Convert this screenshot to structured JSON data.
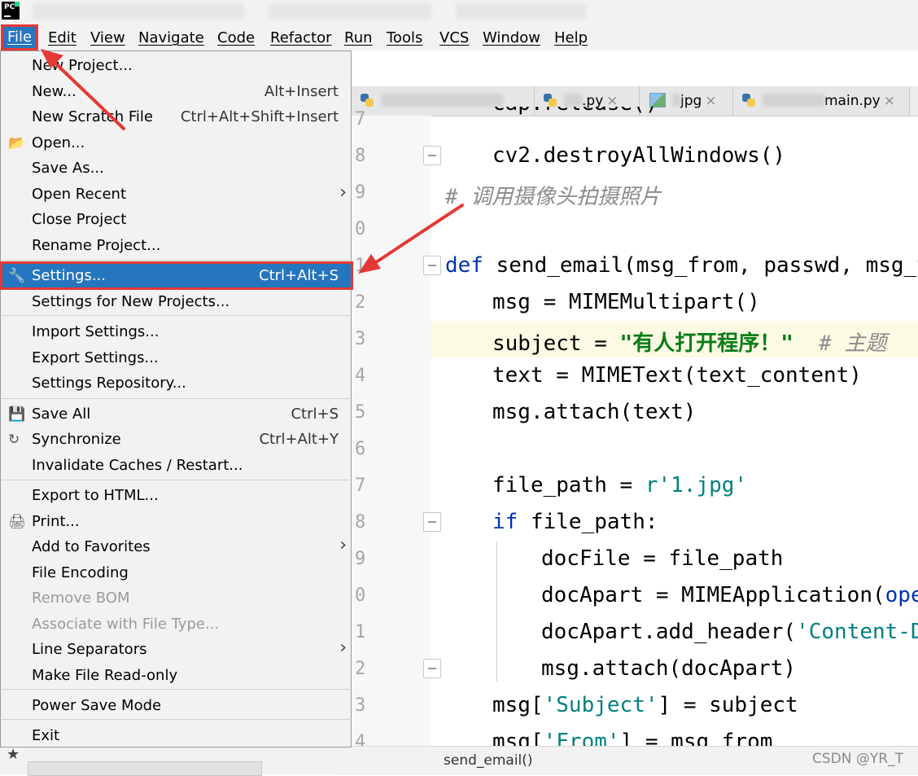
{
  "menubar": {
    "items": [
      "File",
      "Edit",
      "View",
      "Navigate",
      "Code",
      "Refactor",
      "Run",
      "Tools",
      "VCS",
      "Window",
      "Help"
    ]
  },
  "file_menu": {
    "items": [
      {
        "label": "New Project...",
        "shortcut": "",
        "has_submenu": false,
        "icon": ""
      },
      {
        "label": "New...",
        "shortcut": "Alt+Insert",
        "has_submenu": false,
        "icon": ""
      },
      {
        "label": "New Scratch File",
        "shortcut": "Ctrl+Alt+Shift+Insert",
        "has_submenu": false,
        "icon": ""
      },
      {
        "label": "Open...",
        "shortcut": "",
        "has_submenu": false,
        "icon": "folder-icon"
      },
      {
        "label": "Save As...",
        "shortcut": "",
        "has_submenu": false,
        "icon": ""
      },
      {
        "label": "Open Recent",
        "shortcut": "",
        "has_submenu": true,
        "icon": ""
      },
      {
        "label": "Close Project",
        "shortcut": "",
        "has_submenu": false,
        "icon": ""
      },
      {
        "label": "Rename Project...",
        "shortcut": "",
        "has_submenu": false,
        "icon": ""
      },
      {
        "label": "Settings...",
        "shortcut": "Ctrl+Alt+S",
        "has_submenu": false,
        "icon": "wrench-icon",
        "selected": true
      },
      {
        "label": "Settings for New Projects...",
        "shortcut": "",
        "has_submenu": false,
        "icon": ""
      },
      {
        "label": "Import Settings...",
        "shortcut": "",
        "has_submenu": false,
        "icon": ""
      },
      {
        "label": "Export Settings...",
        "shortcut": "",
        "has_submenu": false,
        "icon": ""
      },
      {
        "label": "Settings Repository...",
        "shortcut": "",
        "has_submenu": false,
        "icon": ""
      },
      {
        "label": "Save All",
        "shortcut": "Ctrl+S",
        "has_submenu": false,
        "icon": "save-icon"
      },
      {
        "label": "Synchronize",
        "shortcut": "Ctrl+Alt+Y",
        "has_submenu": false,
        "icon": "sync-icon"
      },
      {
        "label": "Invalidate Caches / Restart...",
        "shortcut": "",
        "has_submenu": false,
        "icon": ""
      },
      {
        "label": "Export to HTML...",
        "shortcut": "",
        "has_submenu": false,
        "icon": ""
      },
      {
        "label": "Print...",
        "shortcut": "",
        "has_submenu": false,
        "icon": "print-icon"
      },
      {
        "label": "Add to Favorites",
        "shortcut": "",
        "has_submenu": true,
        "icon": ""
      },
      {
        "label": "File Encoding",
        "shortcut": "",
        "has_submenu": false,
        "icon": ""
      },
      {
        "label": "Remove BOM",
        "shortcut": "",
        "has_submenu": false,
        "icon": "",
        "disabled": true
      },
      {
        "label": "Associate with File Type...",
        "shortcut": "",
        "has_submenu": false,
        "icon": "",
        "disabled": true
      },
      {
        "label": "Line Separators",
        "shortcut": "",
        "has_submenu": true,
        "icon": ""
      },
      {
        "label": "Make File Read-only",
        "shortcut": "",
        "has_submenu": false,
        "icon": ""
      },
      {
        "label": "Power Save Mode",
        "shortcut": "",
        "has_submenu": false,
        "icon": ""
      },
      {
        "label": "Exit",
        "shortcut": "",
        "has_submenu": false,
        "icon": ""
      }
    ]
  },
  "tabs": [
    {
      "label": "",
      "icon": "python-file-icon"
    },
    {
      "label": ".py",
      "icon": "python-file-icon"
    },
    {
      "label": "jpg",
      "icon": "image-file-icon"
    },
    {
      "label": "main.py",
      "icon": "python-file-icon"
    }
  ],
  "editor": {
    "line_numbers": [
      "7",
      "8",
      "9",
      "0",
      "1",
      "2",
      "3",
      "4",
      "5",
      "6",
      "7",
      "8",
      "9",
      "0",
      "1",
      "2",
      "3",
      "4"
    ],
    "code": {
      "l7": "cap.release()",
      "l8": "cv2.destroyAllWindows()",
      "l9": "# 调用摄像头拍摄照片",
      "l11_kw": "def",
      "l11_rest": " send_email(msg_from, passwd, msg_to",
      "l12": "msg = MIMEMultipart()",
      "l13_a": "subject = ",
      "l13_str": "\"有人打开程序！\"",
      "l13_cmt": "  # 主题",
      "l14": "text = MIMEText(text_content)",
      "l15": "msg.attach(text)",
      "l17_a": "file_path = ",
      "l17_str": "r'1.jpg'",
      "l18_kw": "if",
      "l18_rest": " file_path:",
      "l19": "docFile = file_path",
      "l20_a": "docApart = MIMEApplication(",
      "l20_b": "open",
      "l21_a": "docApart.add_header(",
      "l21_str": "'Content-D",
      "l22": "msg.attach(docApart)",
      "l23_a": "msg[",
      "l23_str": "'Subject'",
      "l23_b": "] = subject",
      "l24_a": "msg[",
      "l24_str": "'From'",
      "l24_b": "] = msg_from"
    },
    "breadcrumb": "send_email()"
  },
  "watermark": "CSDN @YR_T",
  "colors": {
    "selection": "#2675bf",
    "annotation": "#e53935",
    "keyword": "#0033b3",
    "string": "#067d17",
    "comment": "#8c8c8c"
  }
}
